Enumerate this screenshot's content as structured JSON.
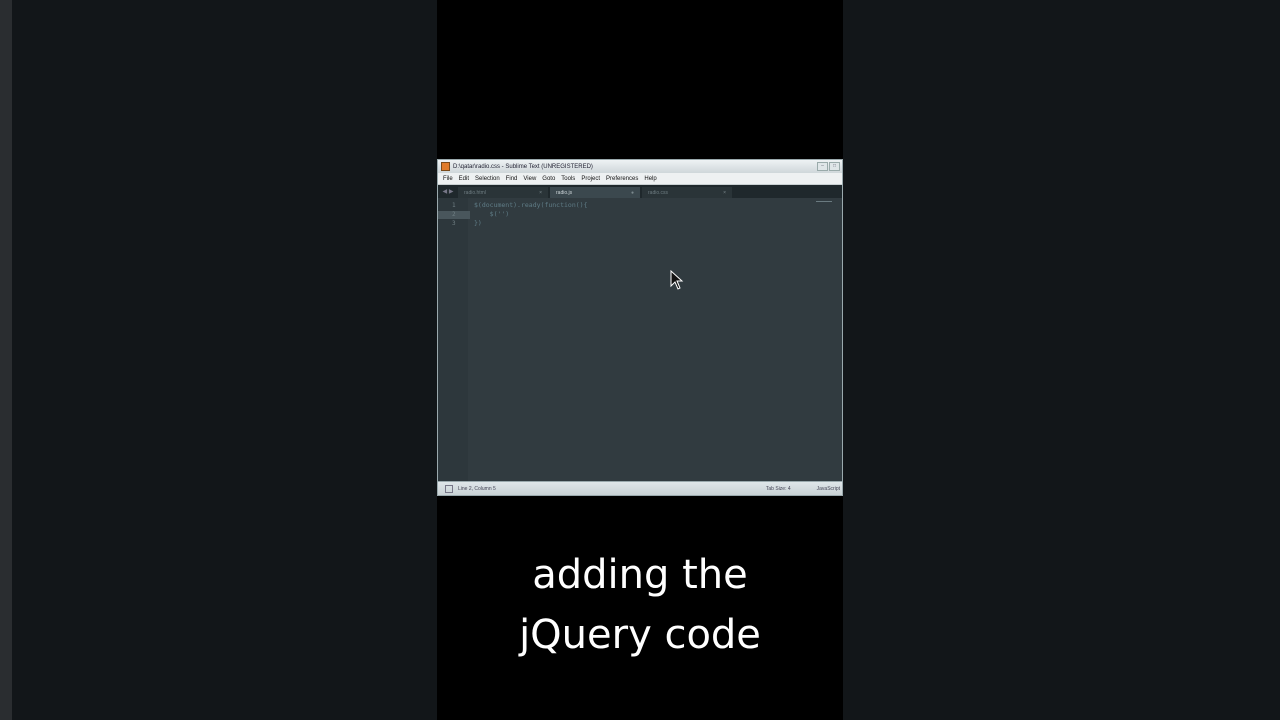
{
  "window": {
    "title": "D:\\qatar\\radio.css - Sublime Text (UNREGISTERED)"
  },
  "menu": {
    "items": [
      "File",
      "Edit",
      "Selection",
      "Find",
      "View",
      "Goto",
      "Tools",
      "Project",
      "Preferences",
      "Help"
    ]
  },
  "tabs": [
    {
      "label": "radio.html",
      "active": false
    },
    {
      "label": "radio.js",
      "active": true
    },
    {
      "label": "radio.css",
      "active": false
    }
  ],
  "editor": {
    "line_numbers": [
      "1",
      "2",
      "3"
    ],
    "lines": [
      "$(document).ready(function(){",
      "    $('')",
      "})"
    ]
  },
  "status": {
    "position": "Line 2, Column 5",
    "tab_size": "Tab Size: 4",
    "syntax": "JavaScript"
  },
  "caption": {
    "line1": "adding the",
    "line2": "jQuery code"
  },
  "colors": {
    "caption_text": "#ffffff",
    "editor_bg": "#313b40",
    "page_bg": "#121619"
  }
}
